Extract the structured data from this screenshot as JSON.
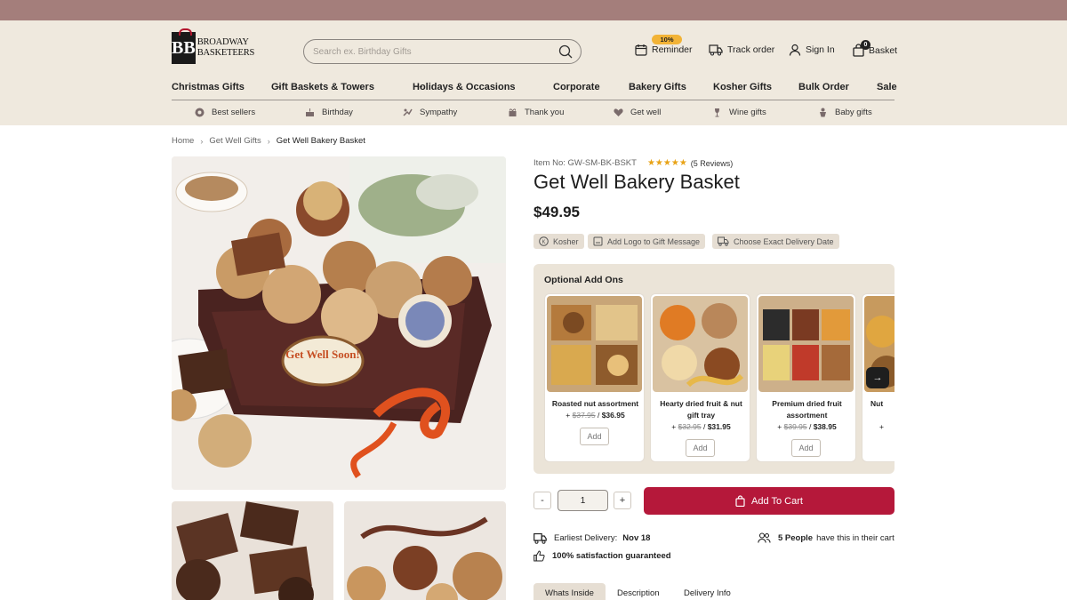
{
  "brand": {
    "logo_line1": "BROADWAY",
    "logo_line2": "BASKETEERS",
    "logo_mark": "BB"
  },
  "search": {
    "placeholder": "Search ex. Birthday Gifts"
  },
  "header_actions": {
    "reminder_badge": "10%",
    "reminder": "Reminder",
    "track_order": "Track order",
    "sign_in": "Sign In",
    "basket": "Basket",
    "basket_count": "0"
  },
  "nav": [
    "Christmas Gifts",
    "Gift Baskets & Towers",
    "Holidays & Occasions",
    "Corporate",
    "Bakery Gifts",
    "Kosher Gifts",
    "Bulk Order",
    "Sale"
  ],
  "subnav": [
    "Best sellers",
    "Birthday",
    "Sympathy",
    "Thank you",
    "Get well",
    "Wine gifts",
    "Baby gifts"
  ],
  "breadcrumb": [
    "Home",
    "Get Well Gifts",
    "Get Well Bakery Basket"
  ],
  "product": {
    "item_no": "Item No: GW-SM-BK-BSKT",
    "stars": "★★★★★",
    "reviews": "(5 Reviews)",
    "title": "Get Well Bakery Basket",
    "price": "$49.95",
    "image_text": "Get Well Soon!",
    "tags": [
      "Kosher",
      "Add Logo to Gift Message",
      "Choose Exact Delivery Date"
    ]
  },
  "addons": {
    "title": "Optional Add Ons",
    "items": [
      {
        "name": "Roasted nut assortment",
        "old_price": "$37.95",
        "new_price": "$36.95",
        "add": "Add"
      },
      {
        "name": "Hearty dried fruit & nut gift tray",
        "old_price": "$32.95",
        "new_price": "$31.95",
        "add": "Add"
      },
      {
        "name": "Premium dried fruit assortment",
        "old_price": "$39.95",
        "new_price": "$38.95",
        "add": "Add"
      },
      {
        "name": "Nut",
        "old_price": "",
        "new_price": "",
        "add": ""
      }
    ]
  },
  "cart": {
    "minus": "-",
    "quantity": "1",
    "plus": "+",
    "add_to_cart": "Add To Cart"
  },
  "delivery": {
    "earliest_label": "Earliest Delivery:",
    "earliest_date": "Nov 18",
    "satisfaction": "100% satisfaction guaranteed",
    "people_count": "5 People",
    "people_text": "have this in their cart"
  },
  "tabs": [
    "Whats Inside",
    "Description",
    "Delivery Info"
  ],
  "colors": {
    "top_band": "#a47e7b",
    "header_bg": "#efe9de",
    "accent_red": "#b5183a",
    "star": "#e8a317",
    "badge": "#f2b336"
  }
}
